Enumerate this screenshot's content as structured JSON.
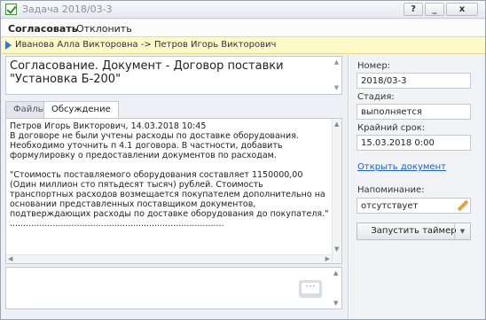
{
  "window": {
    "title": "Задача 2018/03-3",
    "controls": {
      "help": "?",
      "minimize": "_",
      "close": "x"
    }
  },
  "toolbar": {
    "approve": "Согласовать",
    "reject": "Отклонить"
  },
  "flow": {
    "text": "Иванова Алла Викторовна -> Петров Игорь Викторович"
  },
  "subject": {
    "text": "Согласование. Документ - Договор поставки \"Установка Б-200\""
  },
  "tabs": [
    {
      "label": "Файлы"
    },
    {
      "label": "Обсуждение",
      "active": true
    }
  ],
  "discussion": {
    "author": "Петров Игорь Викторович, 14.03.2018 10:45",
    "paragraph1": "В договоре не были учтены расходы по доставке оборудования. Необходимо уточнить п 4.1 договора. В частности, добавить формулировку о предоставлении документов по расходам.",
    "paragraph2": "\"Стоимость поставляемого оборудования составляет 1150000,00 (Один миллион сто пятьдесят тысяч) рублей. Стоимость транспортных расходов возмещается покупателем дополнительно на основании представленных поставщиком документов, подтверждающих расходы по доставке оборудования до покупателя.\"",
    "separator": "................................................................................"
  },
  "details": {
    "number_label": "Номер:",
    "number_value": "2018/03-3",
    "stage_label": "Стадия:",
    "stage_value": "выполняется",
    "deadline_label": "Крайний срок:",
    "deadline_value": "15.03.2018 0:00",
    "open_document": "Открыть документ",
    "reminder_label": "Напоминание:",
    "reminder_value": "отсутствует",
    "timer_button": "Запустить таймер"
  },
  "colors": {
    "link": "#1f5fbf",
    "flow_bg": "#fff8c8",
    "accent": "#3a73c6"
  },
  "icons": [
    "app-check-icon",
    "flow-arrow-icon",
    "pencil-icon",
    "send-message-icon",
    "dropdown-arrow-icon"
  ]
}
